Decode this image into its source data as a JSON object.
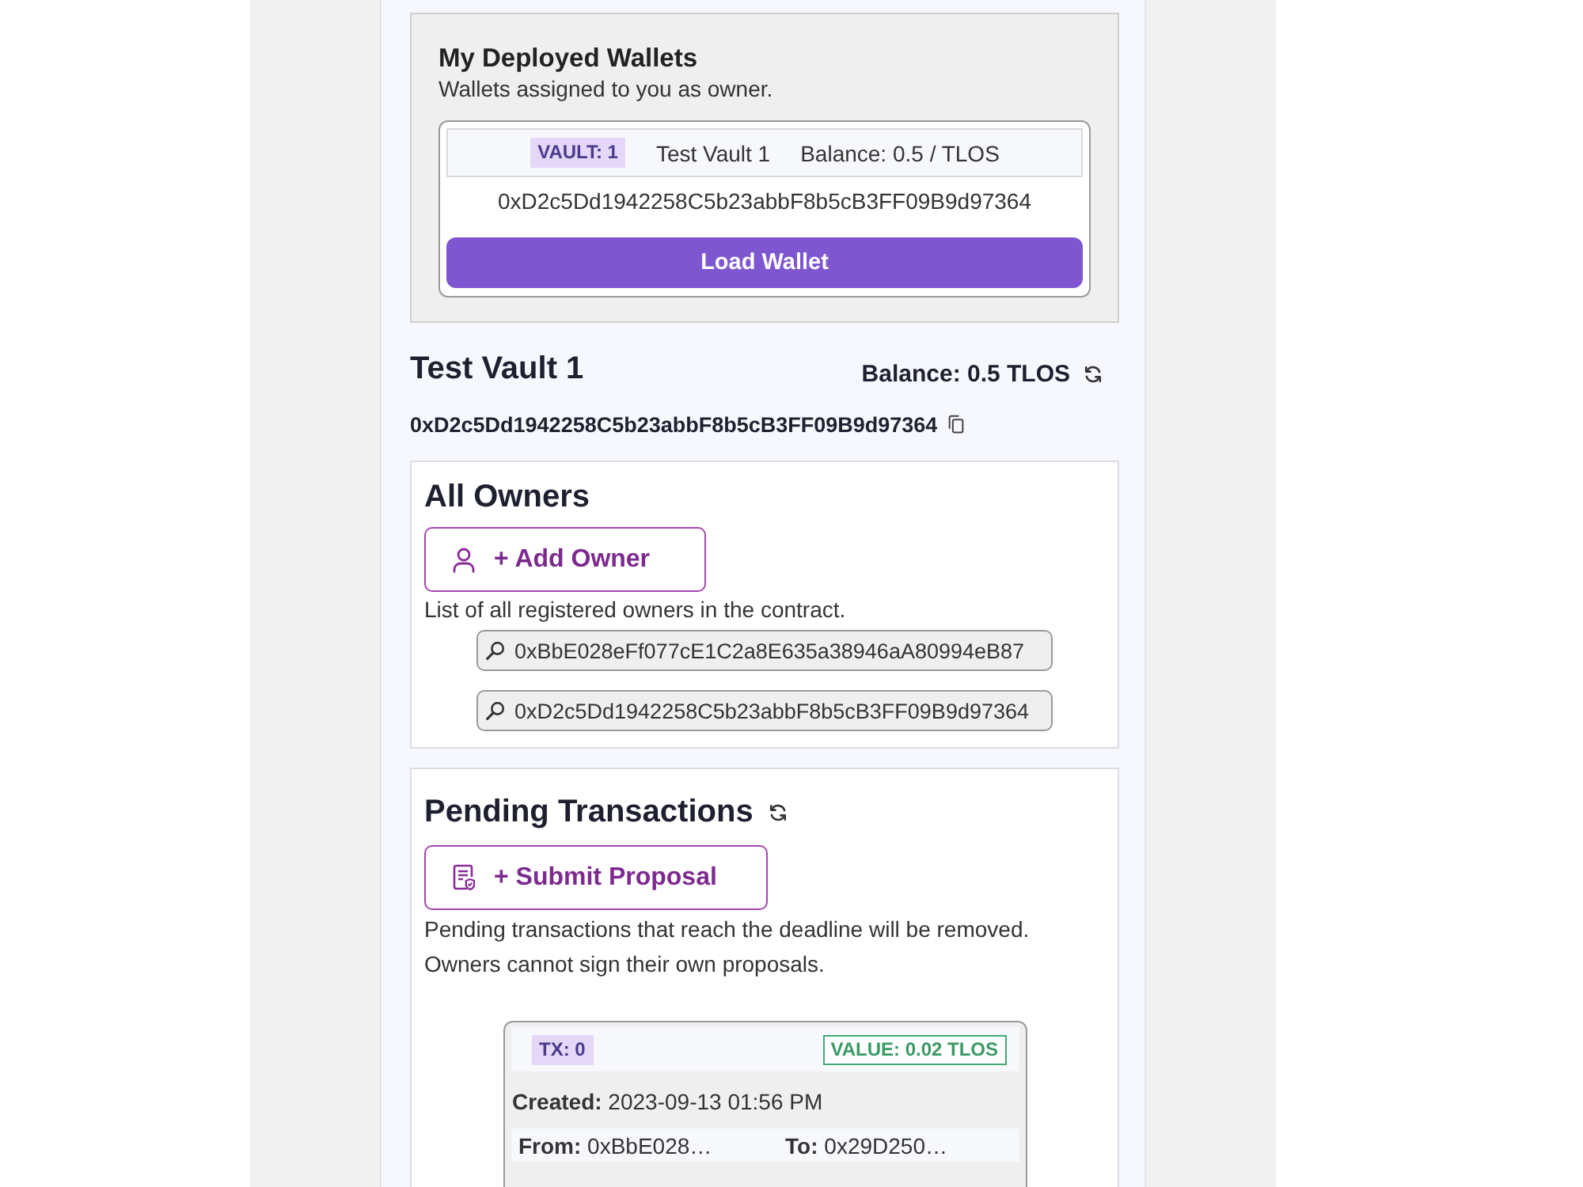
{
  "wallets_panel": {
    "title": "My Deployed Wallets",
    "subtitle": "Wallets assigned to you as owner.",
    "wallets": [
      {
        "badge": "VAULT: 1",
        "name": "Test Vault 1",
        "balance": "Balance: 0.5 / TLOS",
        "address": "0xD2c5Dd1942258C5b23abbF8b5cB3FF09B9d97364",
        "button": "Load Wallet"
      }
    ]
  },
  "vault": {
    "name": "Test Vault 1",
    "balance": "Balance: 0.5 TLOS",
    "address": "0xD2c5Dd1942258C5b23abbF8b5cB3FF09B9d97364"
  },
  "owners": {
    "title": "All Owners",
    "add_button": "+ Add Owner",
    "description": "List of all registered owners in the contract.",
    "addresses": [
      "0xBbE028eFf077cE1C2a8E635a38946aA80994eB87",
      "0xD2c5Dd1942258C5b23abbF8b5cB3FF09B9d97364"
    ]
  },
  "pending": {
    "title": "Pending Transactions",
    "submit_button": "+ Submit Proposal",
    "notes": [
      "Pending transactions that reach the deadline will be removed.",
      "Owners cannot sign their own proposals."
    ],
    "transactions": [
      {
        "tx": "TX: 0",
        "value": "VALUE: 0.02 TLOS",
        "created": "**Created:** 2023-09-13 01:56 PM",
        "from": "**From:** 0xBbE028…",
        "to": "**To:** 0x29D250…"
      }
    ]
  }
}
